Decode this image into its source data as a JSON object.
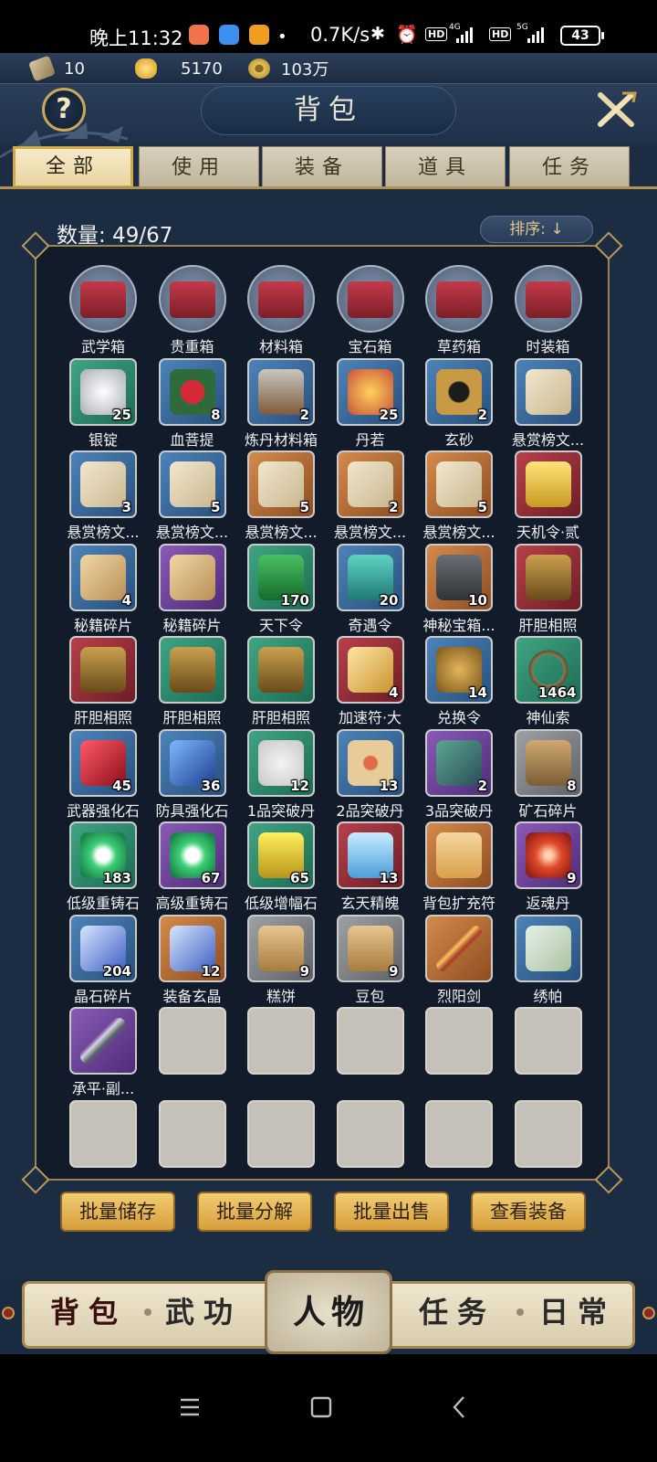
{
  "status_bar": {
    "time": "晚上11:32",
    "network_speed": "0.7K/s",
    "network_1": "4G",
    "network_2": "5G",
    "hd_label": "HD",
    "battery": "43",
    "icons": [
      "notification-app-icon",
      "notification-app-icon",
      "notification-app-icon",
      "bluetooth-icon",
      "alarm-icon"
    ]
  },
  "resources": [
    {
      "icon": "ticket-icon",
      "value": "10"
    },
    {
      "icon": "gold-ingot-icon",
      "value": "5170"
    },
    {
      "icon": "copper-coin-icon",
      "value": "103万"
    }
  ],
  "header": {
    "title": "背包",
    "help_label": "?"
  },
  "tabs": [
    {
      "label": "全部",
      "active": true
    },
    {
      "label": "使用",
      "active": false
    },
    {
      "label": "装备",
      "active": false
    },
    {
      "label": "道具",
      "active": false
    },
    {
      "label": "任务",
      "active": false
    }
  ],
  "inventory": {
    "count_label": "数量: 49/67",
    "sort_label": "排序: ↓",
    "items": [
      {
        "name": "武学箱",
        "qty": "",
        "rarity": "round",
        "icon": "red-chest-icon"
      },
      {
        "name": "贵重箱",
        "qty": "",
        "rarity": "round",
        "icon": "red-chest-icon"
      },
      {
        "name": "材料箱",
        "qty": "",
        "rarity": "round",
        "icon": "red-chest-icon"
      },
      {
        "name": "宝石箱",
        "qty": "",
        "rarity": "round",
        "icon": "red-chest-icon"
      },
      {
        "name": "草药箱",
        "qty": "",
        "rarity": "round",
        "icon": "red-chest-icon"
      },
      {
        "name": "时装箱",
        "qty": "",
        "rarity": "round",
        "icon": "red-chest-icon"
      },
      {
        "name": "银锭",
        "qty": "25",
        "rarity": "green",
        "icon": "silver-ingot-icon"
      },
      {
        "name": "血菩提",
        "qty": "8",
        "rarity": "blue",
        "icon": "berry-icon"
      },
      {
        "name": "炼丹材料箱",
        "qty": "2",
        "rarity": "blue",
        "icon": "chest-icon"
      },
      {
        "name": "丹若",
        "qty": "25",
        "rarity": "blue",
        "icon": "pomegranate-icon"
      },
      {
        "name": "玄砂",
        "qty": "2",
        "rarity": "blue",
        "icon": "sand-bag-icon"
      },
      {
        "name": "悬赏榜文...",
        "qty": "",
        "rarity": "blue",
        "icon": "scroll-icon"
      },
      {
        "name": "悬赏榜文...",
        "qty": "3",
        "rarity": "blue",
        "icon": "scroll-icon"
      },
      {
        "name": "悬赏榜文...",
        "qty": "5",
        "rarity": "blue",
        "icon": "scroll-icon"
      },
      {
        "name": "悬赏榜文...",
        "qty": "5",
        "rarity": "orange",
        "icon": "scroll-icon"
      },
      {
        "name": "悬赏榜文...",
        "qty": "2",
        "rarity": "orange",
        "icon": "scroll-icon"
      },
      {
        "name": "悬赏榜文...",
        "qty": "5",
        "rarity": "orange",
        "icon": "scroll-icon"
      },
      {
        "name": "天机令·贰",
        "qty": "",
        "rarity": "red",
        "icon": "gold-token-icon"
      },
      {
        "name": "秘籍碎片",
        "qty": "4",
        "rarity": "blue",
        "icon": "manual-fragment-icon"
      },
      {
        "name": "秘籍碎片",
        "qty": "",
        "rarity": "purple",
        "icon": "manual-fragment-icon"
      },
      {
        "name": "天下令",
        "qty": "170",
        "rarity": "green",
        "icon": "jade-token-icon"
      },
      {
        "name": "奇遇令",
        "qty": "20",
        "rarity": "blue",
        "icon": "jade-plate-icon"
      },
      {
        "name": "神秘宝箱...",
        "qty": "10",
        "rarity": "orange",
        "icon": "treasure-chest-icon"
      },
      {
        "name": "肝胆相照",
        "qty": "",
        "rarity": "red",
        "icon": "figure-statue-icon"
      },
      {
        "name": "肝胆相照",
        "qty": "",
        "rarity": "red",
        "icon": "figure-statue-icon"
      },
      {
        "name": "肝胆相照",
        "qty": "",
        "rarity": "green",
        "icon": "figure-statue-icon"
      },
      {
        "name": "肝胆相照",
        "qty": "",
        "rarity": "green",
        "icon": "figure-statue-icon"
      },
      {
        "name": "加速符·大",
        "qty": "4",
        "rarity": "red",
        "icon": "flag-icon"
      },
      {
        "name": "兑换令",
        "qty": "14",
        "rarity": "blue",
        "icon": "bronze-medal-icon"
      },
      {
        "name": "神仙索",
        "qty": "1464",
        "rarity": "green",
        "icon": "rope-icon"
      },
      {
        "name": "武器强化石",
        "qty": "45",
        "rarity": "blue",
        "icon": "red-crystal-icon"
      },
      {
        "name": "防具强化石",
        "qty": "36",
        "rarity": "blue",
        "icon": "blue-crystal-icon"
      },
      {
        "name": "1品突破丹",
        "qty": "12",
        "rarity": "green",
        "icon": "pill-cloth-icon"
      },
      {
        "name": "2品突破丹",
        "qty": "13",
        "rarity": "blue",
        "icon": "pill-tray-icon"
      },
      {
        "name": "3品突破丹",
        "qty": "2",
        "rarity": "purple",
        "icon": "pill-box-icon"
      },
      {
        "name": "矿石碎片",
        "qty": "8",
        "rarity": "gray",
        "icon": "ore-bag-icon"
      },
      {
        "name": "低级重铸石",
        "qty": "183",
        "rarity": "green",
        "icon": "recast-orb-icon"
      },
      {
        "name": "高级重铸石",
        "qty": "67",
        "rarity": "purple",
        "icon": "recast-orb-icon"
      },
      {
        "name": "低级增幅石",
        "qty": "65",
        "rarity": "green",
        "icon": "gold-stone-icon"
      },
      {
        "name": "玄天精魄",
        "qty": "13",
        "rarity": "red",
        "icon": "ice-crystal-icon"
      },
      {
        "name": "背包扩充符",
        "qty": "",
        "rarity": "orange",
        "icon": "talisman-icon"
      },
      {
        "name": "返魂丹",
        "qty": "9",
        "rarity": "purple",
        "icon": "soul-orb-icon"
      },
      {
        "name": "晶石碎片",
        "qty": "204",
        "rarity": "blue",
        "icon": "crystal-shard-icon"
      },
      {
        "name": "装备玄晶",
        "qty": "12",
        "rarity": "orange",
        "icon": "crystal-shard-icon"
      },
      {
        "name": "糕饼",
        "qty": "9",
        "rarity": "gray",
        "icon": "food-parcel-icon"
      },
      {
        "name": "豆包",
        "qty": "9",
        "rarity": "gray",
        "icon": "food-parcel-icon"
      },
      {
        "name": "烈阳剑",
        "qty": "",
        "rarity": "orange",
        "icon": "sword-icon"
      },
      {
        "name": "绣帕",
        "qty": "",
        "rarity": "blue",
        "icon": "handkerchief-icon"
      },
      {
        "name": "承平·副...",
        "qty": "",
        "rarity": "purple",
        "icon": "blade-icon"
      }
    ],
    "total_slots": 60
  },
  "actions": [
    "批量储存",
    "批量分解",
    "批量出售",
    "查看装备"
  ],
  "bottom_nav": [
    {
      "label": "背包",
      "active": true
    },
    {
      "label": "武功",
      "active": false
    },
    {
      "label": "人物",
      "active": false
    },
    {
      "label": "任务",
      "active": false
    },
    {
      "label": "日常",
      "active": false
    }
  ],
  "system_nav": [
    "menu-icon",
    "home-icon",
    "back-icon"
  ],
  "colors": {
    "accent_gold": "#d3a844",
    "panel_bg": "#111b2a",
    "page_bg": "#1c2c42"
  }
}
